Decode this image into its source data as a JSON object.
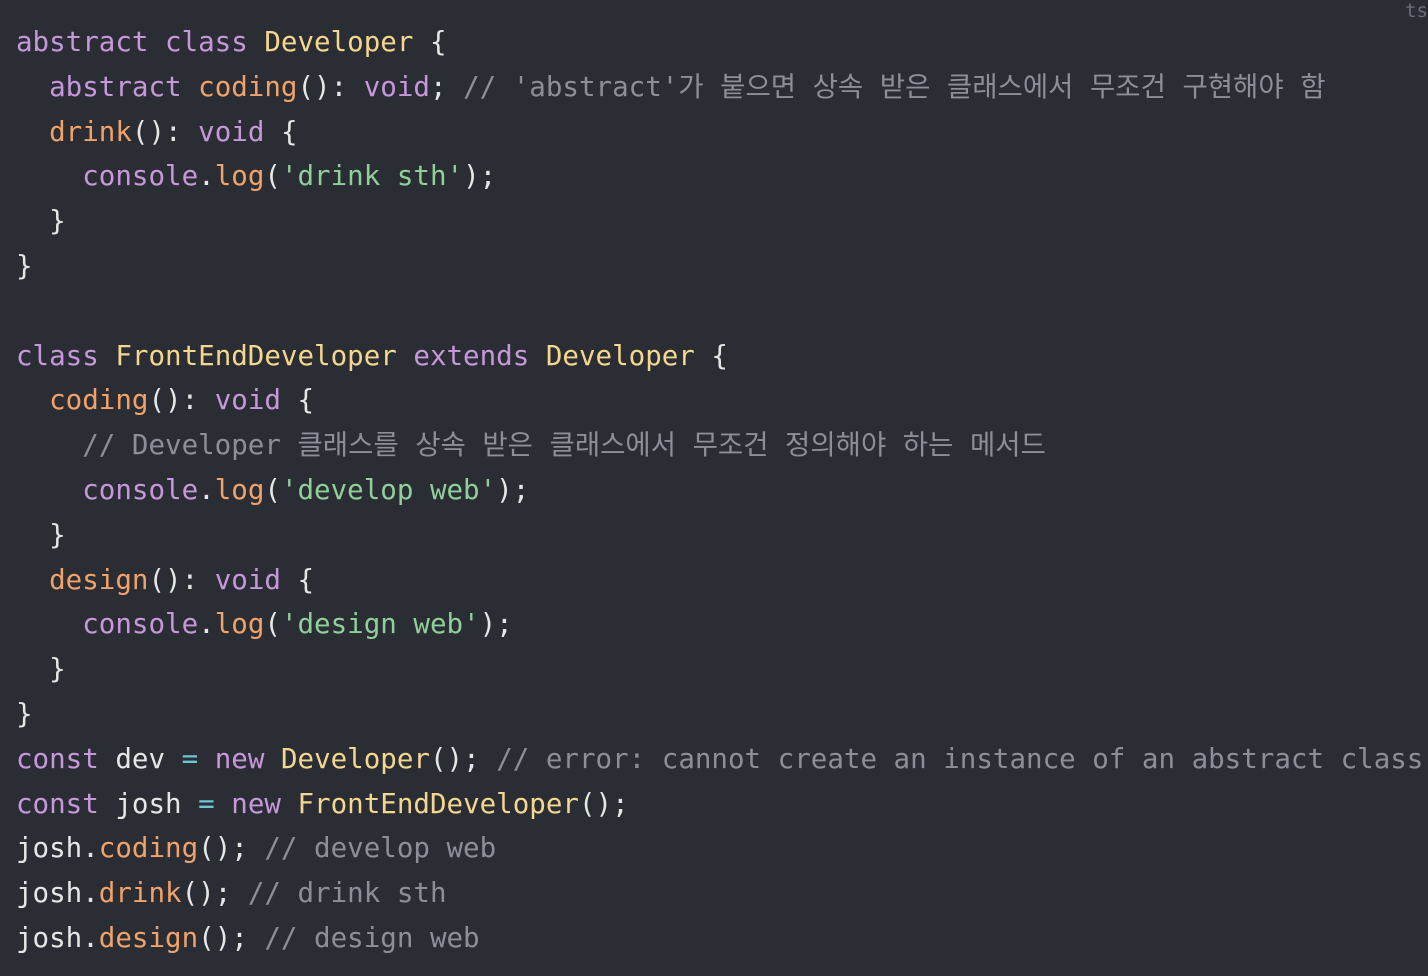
{
  "snippet": {
    "language_label": "ts",
    "lines": [
      [
        {
          "t": "abstract",
          "k": "keyword"
        },
        {
          "t": " ",
          "k": "plain"
        },
        {
          "t": "class",
          "k": "keyword"
        },
        {
          "t": " ",
          "k": "plain"
        },
        {
          "t": "Developer",
          "k": "class"
        },
        {
          "t": " {",
          "k": "plain"
        }
      ],
      [
        {
          "t": "  ",
          "k": "plain"
        },
        {
          "t": "abstract",
          "k": "keyword"
        },
        {
          "t": " ",
          "k": "plain"
        },
        {
          "t": "coding",
          "k": "func"
        },
        {
          "t": "(): ",
          "k": "plain"
        },
        {
          "t": "void",
          "k": "keyword"
        },
        {
          "t": "; ",
          "k": "plain"
        },
        {
          "t": "// 'abstract'가 붙으면 상속 받은 클래스에서 무조건 구현해야 함",
          "k": "comment"
        }
      ],
      [
        {
          "t": "  ",
          "k": "plain"
        },
        {
          "t": "drink",
          "k": "func"
        },
        {
          "t": "(): ",
          "k": "plain"
        },
        {
          "t": "void",
          "k": "keyword"
        },
        {
          "t": " {",
          "k": "plain"
        }
      ],
      [
        {
          "t": "    ",
          "k": "plain"
        },
        {
          "t": "console",
          "k": "obj"
        },
        {
          "t": ".",
          "k": "plain"
        },
        {
          "t": "log",
          "k": "func"
        },
        {
          "t": "(",
          "k": "plain"
        },
        {
          "t": "'drink sth'",
          "k": "string"
        },
        {
          "t": ");",
          "k": "plain"
        }
      ],
      [
        {
          "t": "  }",
          "k": "plain"
        }
      ],
      [
        {
          "t": "}",
          "k": "plain"
        }
      ],
      [],
      [
        {
          "t": "class",
          "k": "keyword"
        },
        {
          "t": " ",
          "k": "plain"
        },
        {
          "t": "FrontEndDeveloper",
          "k": "class"
        },
        {
          "t": " ",
          "k": "plain"
        },
        {
          "t": "extends",
          "k": "keyword"
        },
        {
          "t": " ",
          "k": "plain"
        },
        {
          "t": "Developer",
          "k": "class"
        },
        {
          "t": " {",
          "k": "plain"
        }
      ],
      [
        {
          "t": "  ",
          "k": "plain"
        },
        {
          "t": "coding",
          "k": "func"
        },
        {
          "t": "(): ",
          "k": "plain"
        },
        {
          "t": "void",
          "k": "keyword"
        },
        {
          "t": " {",
          "k": "plain"
        }
      ],
      [
        {
          "t": "    ",
          "k": "plain"
        },
        {
          "t": "// Developer 클래스를 상속 받은 클래스에서 무조건 정의해야 하는 메서드",
          "k": "comment"
        }
      ],
      [
        {
          "t": "    ",
          "k": "plain"
        },
        {
          "t": "console",
          "k": "obj"
        },
        {
          "t": ".",
          "k": "plain"
        },
        {
          "t": "log",
          "k": "func"
        },
        {
          "t": "(",
          "k": "plain"
        },
        {
          "t": "'develop web'",
          "k": "string"
        },
        {
          "t": ");",
          "k": "plain"
        }
      ],
      [
        {
          "t": "  }",
          "k": "plain"
        }
      ],
      [
        {
          "t": "  ",
          "k": "plain"
        },
        {
          "t": "design",
          "k": "func"
        },
        {
          "t": "(): ",
          "k": "plain"
        },
        {
          "t": "void",
          "k": "keyword"
        },
        {
          "t": " {",
          "k": "plain"
        }
      ],
      [
        {
          "t": "    ",
          "k": "plain"
        },
        {
          "t": "console",
          "k": "obj"
        },
        {
          "t": ".",
          "k": "plain"
        },
        {
          "t": "log",
          "k": "func"
        },
        {
          "t": "(",
          "k": "plain"
        },
        {
          "t": "'design web'",
          "k": "string"
        },
        {
          "t": ");",
          "k": "plain"
        }
      ],
      [
        {
          "t": "  }",
          "k": "plain"
        }
      ],
      [
        {
          "t": "}",
          "k": "plain"
        }
      ],
      [
        {
          "t": "const",
          "k": "keyword"
        },
        {
          "t": " dev ",
          "k": "plain"
        },
        {
          "t": "=",
          "k": "op"
        },
        {
          "t": " ",
          "k": "plain"
        },
        {
          "t": "new",
          "k": "keyword"
        },
        {
          "t": " ",
          "k": "plain"
        },
        {
          "t": "Developer",
          "k": "class"
        },
        {
          "t": "(); ",
          "k": "plain"
        },
        {
          "t": "// error: cannot create an instance of an abstract class",
          "k": "comment"
        }
      ],
      [
        {
          "t": "const",
          "k": "keyword"
        },
        {
          "t": " josh ",
          "k": "plain"
        },
        {
          "t": "=",
          "k": "op"
        },
        {
          "t": " ",
          "k": "plain"
        },
        {
          "t": "new",
          "k": "keyword"
        },
        {
          "t": " ",
          "k": "plain"
        },
        {
          "t": "FrontEndDeveloper",
          "k": "class"
        },
        {
          "t": "();",
          "k": "plain"
        }
      ],
      [
        {
          "t": "josh.",
          "k": "plain"
        },
        {
          "t": "coding",
          "k": "func"
        },
        {
          "t": "(); ",
          "k": "plain"
        },
        {
          "t": "// develop web",
          "k": "comment"
        }
      ],
      [
        {
          "t": "josh.",
          "k": "plain"
        },
        {
          "t": "drink",
          "k": "func"
        },
        {
          "t": "(); ",
          "k": "plain"
        },
        {
          "t": "// drink sth",
          "k": "comment"
        }
      ],
      [
        {
          "t": "josh.",
          "k": "plain"
        },
        {
          "t": "design",
          "k": "func"
        },
        {
          "t": "(); ",
          "k": "plain"
        },
        {
          "t": "// design web",
          "k": "comment"
        }
      ]
    ]
  }
}
